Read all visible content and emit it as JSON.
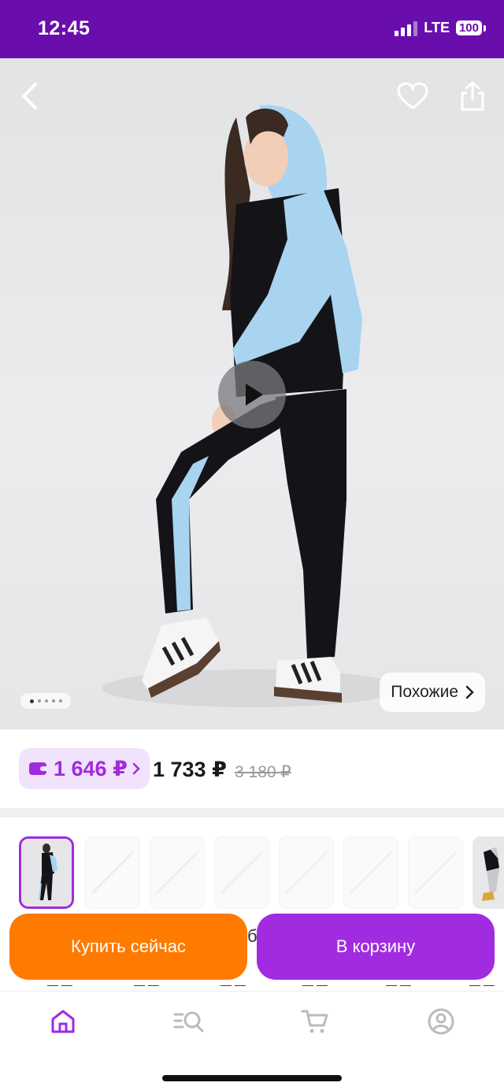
{
  "status_bar": {
    "time": "12:45",
    "network": "LTE",
    "battery": "100"
  },
  "photo": {
    "back_icon": "chevron-left-icon",
    "favorite_icon": "heart-icon",
    "share_icon": "share-icon",
    "play_icon": "play-icon",
    "gallery_dots": {
      "count": 5,
      "active_index": 0
    },
    "similar_label": "Похожие"
  },
  "price": {
    "wallet_price": "1 646 ₽",
    "price": "1 733 ₽",
    "old_price": "3 180 ₽"
  },
  "variants": {
    "peek_text": "б"
  },
  "actions": {
    "buy_now": "Купить сейчас",
    "add_to_cart": "В корзину"
  },
  "bottom_nav": {
    "items": [
      {
        "name": "home",
        "icon": "home-icon",
        "active": true
      },
      {
        "name": "catalog",
        "icon": "catalog-search-icon",
        "active": false
      },
      {
        "name": "cart",
        "icon": "cart-icon",
        "active": false
      },
      {
        "name": "profile",
        "icon": "profile-icon",
        "active": false
      }
    ]
  },
  "colors": {
    "brand_purple": "#a12be0",
    "status_purple": "#6a0dad",
    "orange": "#ff7a00"
  }
}
